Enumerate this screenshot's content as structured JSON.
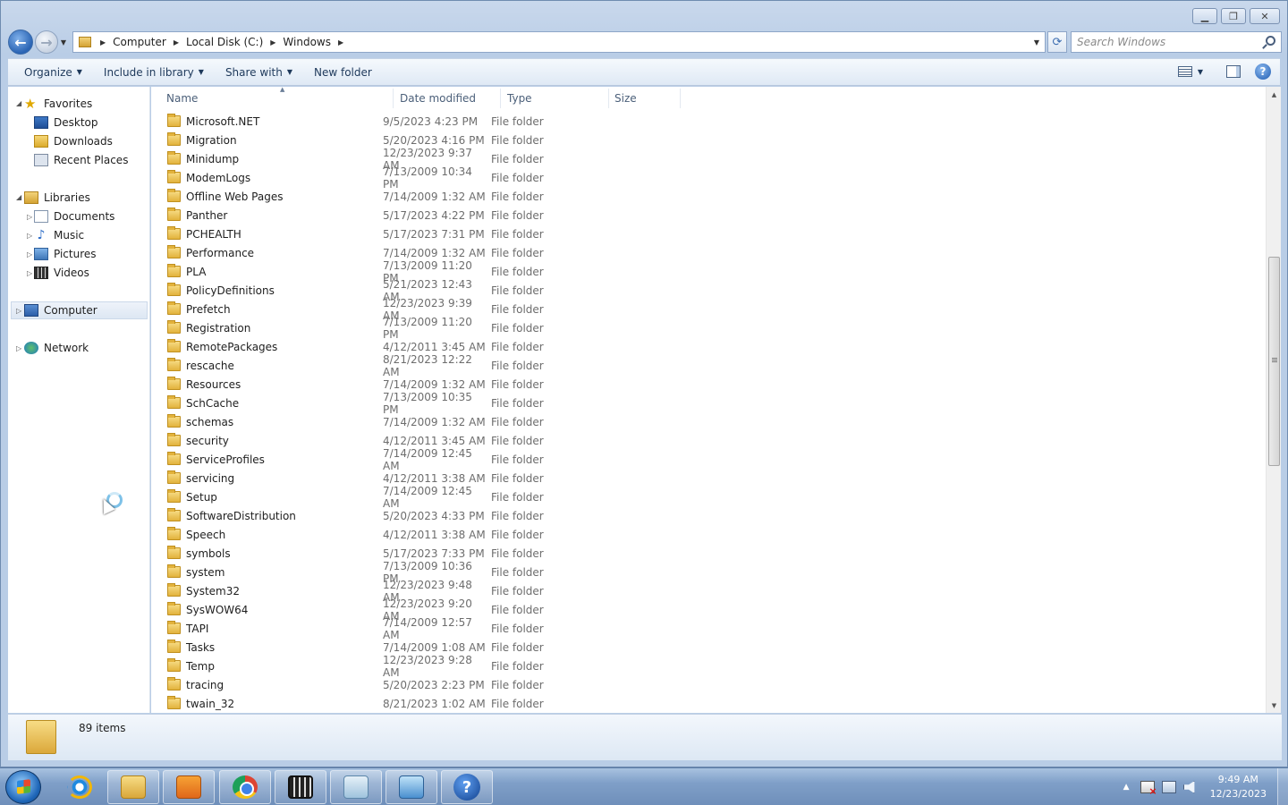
{
  "window": {
    "caption_buttons": [
      "minimize",
      "maximize",
      "close"
    ]
  },
  "address": {
    "crumbs": [
      "Computer",
      "Local Disk (C:)",
      "Windows"
    ]
  },
  "search": {
    "placeholder": "Search Windows"
  },
  "commandbar": {
    "organize": "Organize",
    "include_in_library": "Include in library",
    "share_with": "Share with",
    "new_folder": "New folder"
  },
  "navpane": {
    "favorites": "Favorites",
    "favorites_items": [
      "Desktop",
      "Downloads",
      "Recent Places"
    ],
    "libraries": "Libraries",
    "libraries_items": [
      "Documents",
      "Music",
      "Pictures",
      "Videos"
    ],
    "computer": "Computer",
    "network": "Network"
  },
  "columns": {
    "name": "Name",
    "date": "Date modified",
    "type": "Type",
    "size": "Size"
  },
  "files": [
    {
      "name": "Microsoft.NET",
      "date": "9/5/2023 4:23 PM",
      "type": "File folder"
    },
    {
      "name": "Migration",
      "date": "5/20/2023 4:16 PM",
      "type": "File folder"
    },
    {
      "name": "Minidump",
      "date": "12/23/2023 9:37 AM",
      "type": "File folder"
    },
    {
      "name": "ModemLogs",
      "date": "7/13/2009 10:34 PM",
      "type": "File folder"
    },
    {
      "name": "Offline Web Pages",
      "date": "7/14/2009 1:32 AM",
      "type": "File folder"
    },
    {
      "name": "Panther",
      "date": "5/17/2023 4:22 PM",
      "type": "File folder"
    },
    {
      "name": "PCHEALTH",
      "date": "5/17/2023 7:31 PM",
      "type": "File folder"
    },
    {
      "name": "Performance",
      "date": "7/14/2009 1:32 AM",
      "type": "File folder"
    },
    {
      "name": "PLA",
      "date": "7/13/2009 11:20 PM",
      "type": "File folder"
    },
    {
      "name": "PolicyDefinitions",
      "date": "5/21/2023 12:43 AM",
      "type": "File folder"
    },
    {
      "name": "Prefetch",
      "date": "12/23/2023 9:39 AM",
      "type": "File folder"
    },
    {
      "name": "Registration",
      "date": "7/13/2009 11:20 PM",
      "type": "File folder"
    },
    {
      "name": "RemotePackages",
      "date": "4/12/2011 3:45 AM",
      "type": "File folder"
    },
    {
      "name": "rescache",
      "date": "8/21/2023 12:22 AM",
      "type": "File folder"
    },
    {
      "name": "Resources",
      "date": "7/14/2009 1:32 AM",
      "type": "File folder"
    },
    {
      "name": "SchCache",
      "date": "7/13/2009 10:35 PM",
      "type": "File folder"
    },
    {
      "name": "schemas",
      "date": "7/14/2009 1:32 AM",
      "type": "File folder"
    },
    {
      "name": "security",
      "date": "4/12/2011 3:45 AM",
      "type": "File folder"
    },
    {
      "name": "ServiceProfiles",
      "date": "7/14/2009 12:45 AM",
      "type": "File folder"
    },
    {
      "name": "servicing",
      "date": "4/12/2011 3:38 AM",
      "type": "File folder"
    },
    {
      "name": "Setup",
      "date": "7/14/2009 12:45 AM",
      "type": "File folder"
    },
    {
      "name": "SoftwareDistribution",
      "date": "5/20/2023 4:33 PM",
      "type": "File folder"
    },
    {
      "name": "Speech",
      "date": "4/12/2011 3:38 AM",
      "type": "File folder"
    },
    {
      "name": "symbols",
      "date": "5/17/2023 7:33 PM",
      "type": "File folder"
    },
    {
      "name": "system",
      "date": "7/13/2009 10:36 PM",
      "type": "File folder"
    },
    {
      "name": "System32",
      "date": "12/23/2023 9:48 AM",
      "type": "File folder"
    },
    {
      "name": "SysWOW64",
      "date": "12/23/2023 9:20 AM",
      "type": "File folder"
    },
    {
      "name": "TAPI",
      "date": "7/14/2009 12:57 AM",
      "type": "File folder"
    },
    {
      "name": "Tasks",
      "date": "7/14/2009 1:08 AM",
      "type": "File folder"
    },
    {
      "name": "Temp",
      "date": "12/23/2023 9:28 AM",
      "type": "File folder"
    },
    {
      "name": "tracing",
      "date": "5/20/2023 2:23 PM",
      "type": "File folder"
    },
    {
      "name": "twain_32",
      "date": "8/21/2023 1:02 AM",
      "type": "File folder"
    }
  ],
  "details": {
    "count": "89 items"
  },
  "taskbar": {
    "apps": [
      "internet-explorer",
      "windows-explorer",
      "media-player",
      "chrome",
      "movie-maker",
      "document-viewer",
      "control-panel",
      "help"
    ],
    "time": "9:49 AM",
    "date": "12/23/2023"
  }
}
